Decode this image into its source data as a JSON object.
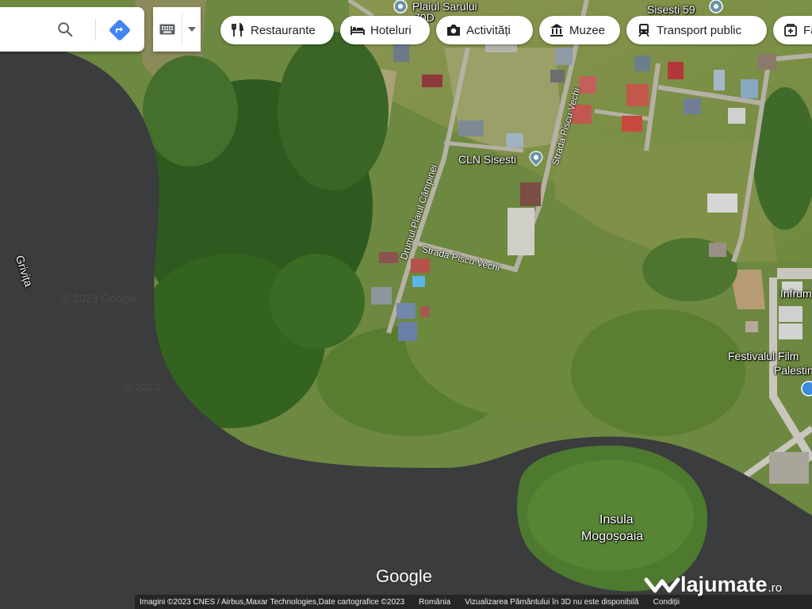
{
  "toolbar": {
    "search_icon": "search-icon",
    "directions_icon": "directions-icon",
    "keyboard_icon": "keyboard-icon",
    "dropdown_icon": "caret-down-icon"
  },
  "chips": [
    {
      "label": "Restaurante",
      "icon": "restaurant-icon"
    },
    {
      "label": "Hoteluri",
      "icon": "hotel-icon"
    },
    {
      "label": "Activități",
      "icon": "camera-icon"
    },
    {
      "label": "Muzee",
      "icon": "museum-icon"
    },
    {
      "label": "Transport public",
      "icon": "transit-icon"
    },
    {
      "label": "Fa",
      "icon": "pharmacy-icon"
    }
  ],
  "places": {
    "top_pin_text": "Plaiul Sarului",
    "top_pin_sub": "70D",
    "top_right_text": "Sisesti 59",
    "cln": "CLN Sisesti",
    "infrum": "Infrum",
    "festival_line1": "Festivalul Film",
    "festival_line2": "Palestin"
  },
  "streets": {
    "drumul": "Drumul Plaiul Câmpinei",
    "piscu_vechi_1": "Strada Piscu Vechi",
    "piscu_vechi_2": "Strada Piscu Vechi"
  },
  "water": {
    "lake_name": "Grivița",
    "island_line1": "Insula",
    "island_line2": "Mogoșoaia"
  },
  "footer": {
    "logo": "Google",
    "imagery": "Imagini ©2023 CNES / Airbus,Maxar Technologies,Date cartografice ©2023",
    "country": "România",
    "satellite_note": "Vizualizarea Pământului în 3D nu este disponibilă",
    "terms": "Condiții"
  },
  "watermark": {
    "brand": "lajumate",
    "tld": ".ro"
  },
  "colors": {
    "water": "#3a3c3e",
    "vegetation": "#5f7f38",
    "chip_text": "#202124",
    "directions_blue": "#4285f4"
  }
}
